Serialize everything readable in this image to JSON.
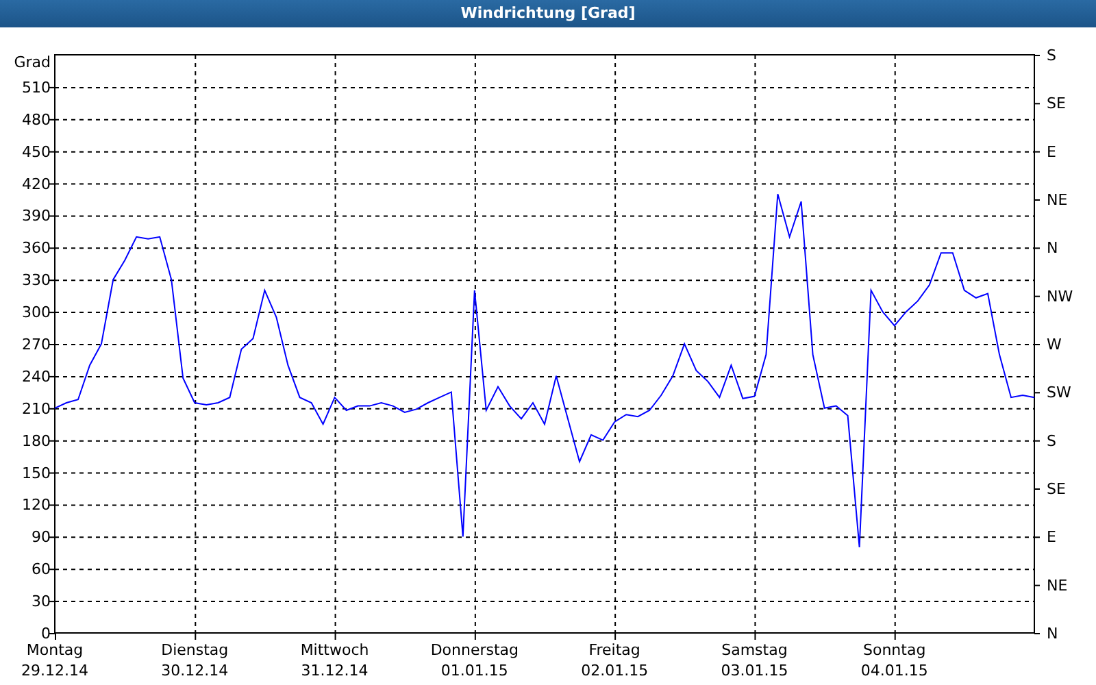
{
  "window": {
    "title": "Windrichtung [Grad]"
  },
  "chart": {
    "compass_labels": [
      "S",
      "SE",
      "E",
      "NE",
      "N",
      "NW",
      "W",
      "SW",
      "S",
      "SE",
      "E",
      "NE",
      "N"
    ],
    "chart_data": {
      "type": "line",
      "grid": true,
      "ylabel": "Grad",
      "ylim": [
        0,
        540
      ],
      "yticks": [
        0,
        30,
        60,
        90,
        120,
        150,
        180,
        210,
        240,
        270,
        300,
        330,
        360,
        390,
        420,
        450,
        480,
        510
      ],
      "categories": [
        "Montag\n29.12.14",
        null,
        null,
        null,
        null,
        null,
        null,
        null,
        null,
        null,
        null,
        null,
        "Dienstag\n30.12.14",
        null,
        null,
        null,
        null,
        null,
        null,
        null,
        null,
        null,
        null,
        null,
        "Mittwoch\n31.12.14",
        null,
        null,
        null,
        null,
        null,
        null,
        null,
        null,
        null,
        null,
        null,
        "Donnerstag\n01.01.15",
        null,
        null,
        null,
        null,
        null,
        null,
        null,
        null,
        null,
        null,
        null,
        "Freitag\n02.01.15",
        null,
        null,
        null,
        null,
        null,
        null,
        null,
        null,
        null,
        null,
        null,
        "Samstag\n03.01.15",
        null,
        null,
        null,
        null,
        null,
        null,
        null,
        null,
        null,
        null,
        null,
        "Sonntag\n04.01.15",
        null,
        null,
        null,
        null,
        null,
        null,
        null,
        null,
        null,
        null,
        null,
        null
      ],
      "series": [
        {
          "color": "#0000ff",
          "values": [
            210,
            215,
            218,
            250,
            270,
            330,
            348,
            370,
            368,
            370,
            330,
            238,
            215,
            213,
            215,
            220,
            265,
            275,
            320,
            295,
            250,
            220,
            215,
            195,
            220,
            208,
            212,
            212,
            215,
            212,
            206,
            209,
            215,
            220,
            225,
            90,
            320,
            208,
            230,
            212,
            200,
            215,
            195,
            240,
            200,
            160,
            185,
            180,
            197,
            204,
            202,
            208,
            222,
            240,
            270,
            245,
            235,
            220,
            250,
            219,
            221,
            260,
            410,
            370,
            403,
            260,
            210,
            212,
            203,
            80,
            320,
            300,
            287,
            300,
            310,
            325,
            355,
            355,
            320,
            313,
            317,
            260,
            220,
            222,
            220
          ]
        }
      ]
    }
  }
}
